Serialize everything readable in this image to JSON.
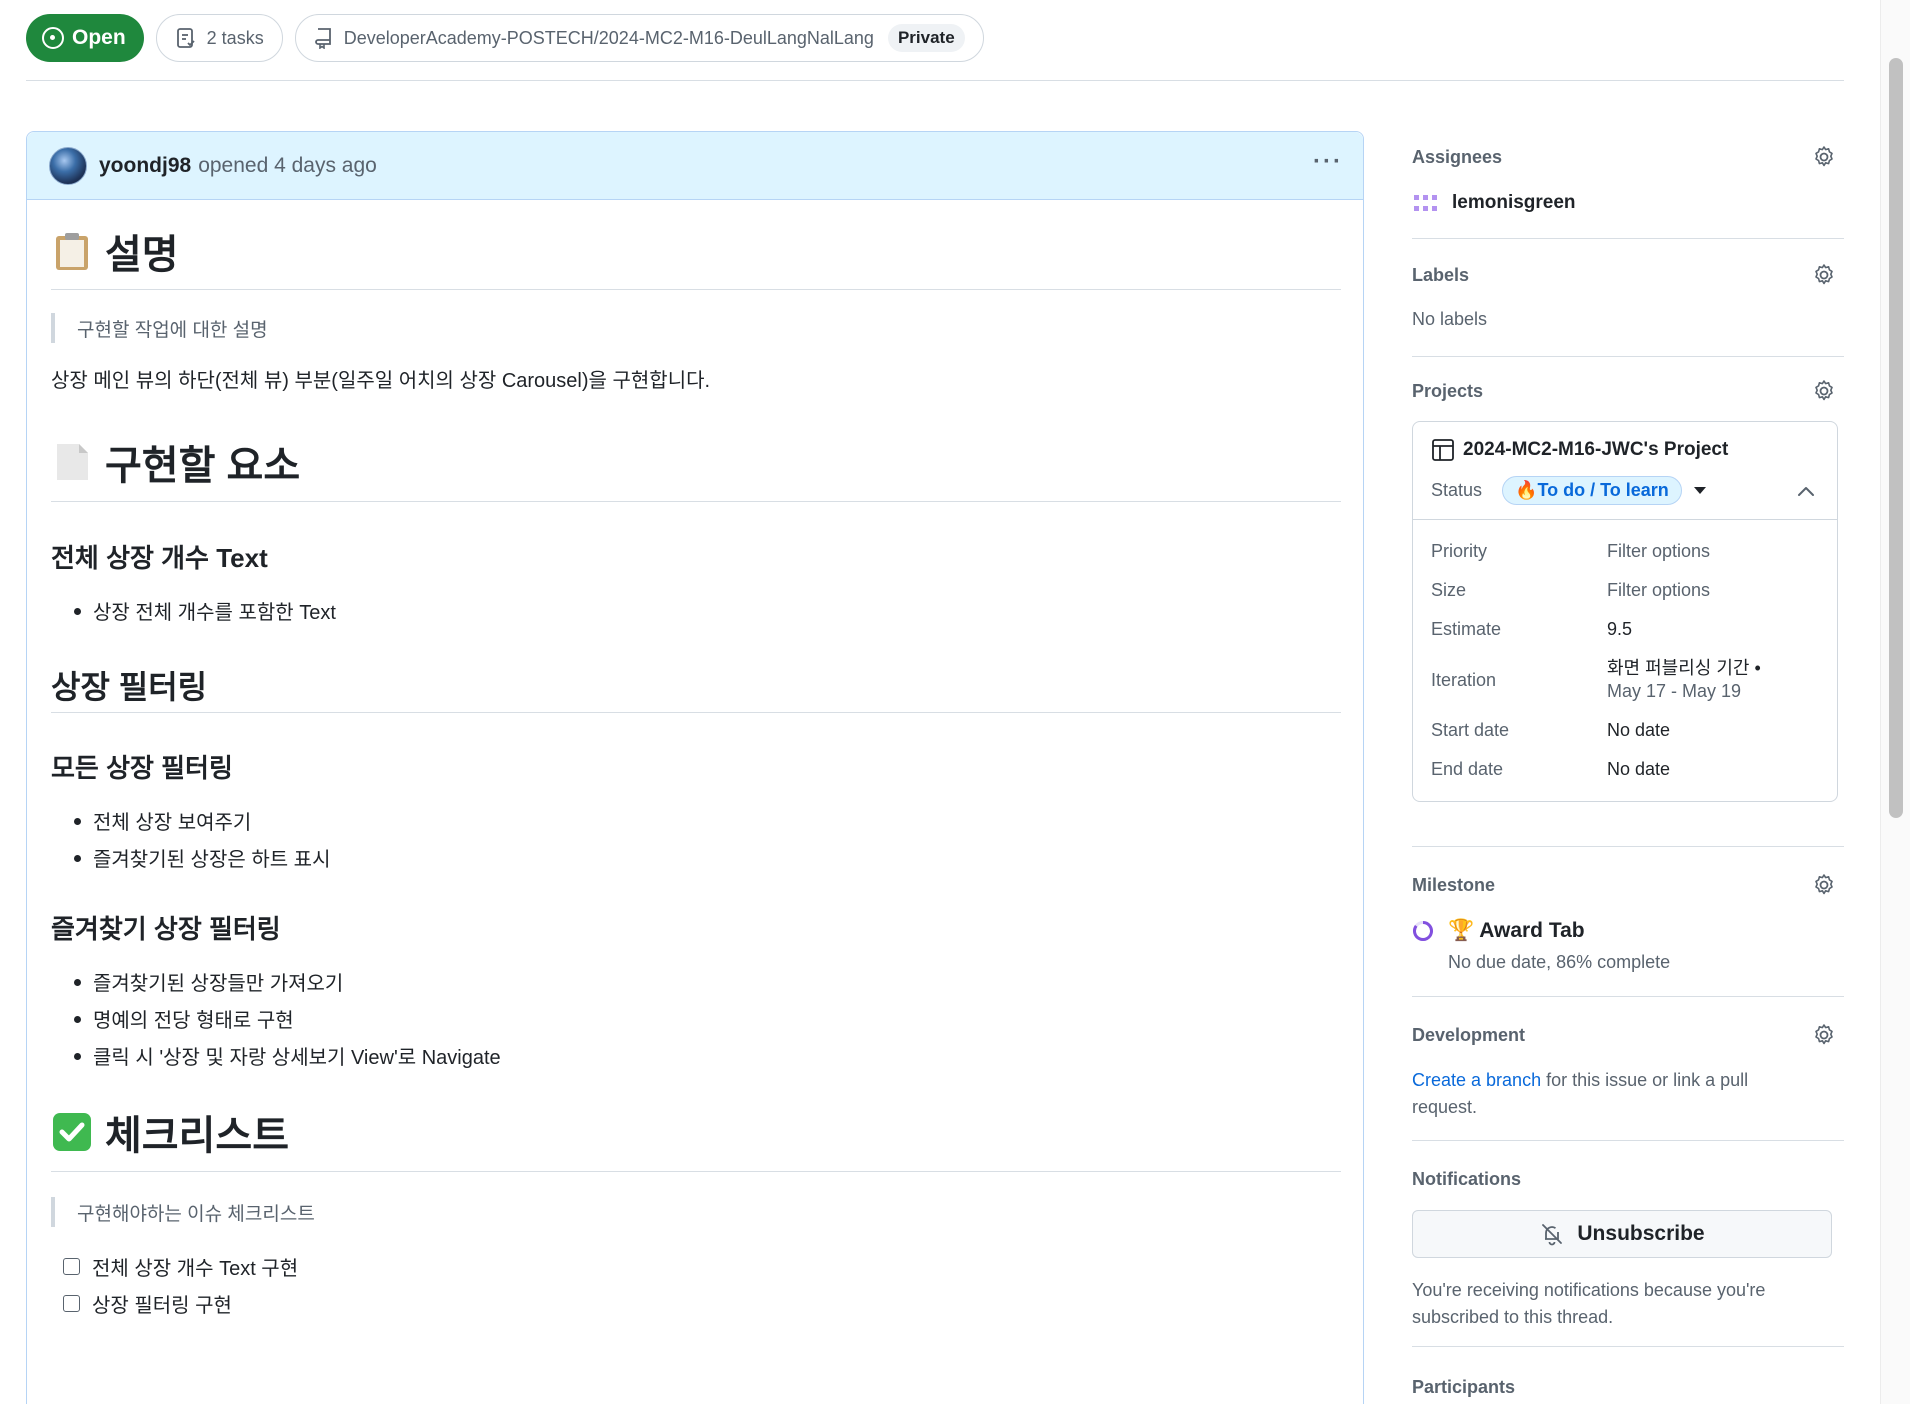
{
  "topbar": {
    "state": "Open",
    "tasks": "2 tasks",
    "repo": "DeveloperAcademy-POSTECH/2024-MC2-M16-DeulLangNalLang",
    "visibility": "Private"
  },
  "comment": {
    "author": "yoondj98",
    "opened": "opened 4 days ago",
    "heading1": "설명",
    "quote1": "구현할 작업에 대한 설명",
    "para1": "상장 메인 뷰의 하단(전체 뷰) 부분(일주일 어치의 상장 Carousel)을 구현합니다.",
    "heading2": "구현할 요소",
    "h3_total": "전체 상장 개수 Text",
    "list_total": [
      "상장 전체 개수를 포함한 Text"
    ],
    "h2_filter": "상장 필터링",
    "h3_all": "모든 상장 필터링",
    "list_all": [
      "전체 상장 보여주기",
      "즐겨찾기된 상장은 하트 표시"
    ],
    "h3_fav": "즐겨찾기 상장 필터링",
    "list_fav": [
      "즐겨찾기된 상장들만 가져오기",
      "명예의 전당 형태로 구현",
      "클릭 시 '상장 및 자랑 상세보기 View'로 Navigate"
    ],
    "heading3": "체크리스트",
    "quote2": "구현해야하는 이슈 체크리스트",
    "tasks": [
      "전체 상장 개수 Text 구현",
      "상장 필터링 구현"
    ]
  },
  "sidebar": {
    "assignees_title": "Assignees",
    "assignee": "lemonisgreen",
    "labels_title": "Labels",
    "labels_value": "No labels",
    "projects_title": "Projects",
    "project_name": "2024-MC2-M16-JWC's Project",
    "status_label": "Status",
    "status_value": "🔥To do / To learn",
    "fields": [
      {
        "key": "Priority",
        "value": "Filter options"
      },
      {
        "key": "Size",
        "value": "Filter options"
      },
      {
        "key": "Estimate",
        "value": "9.5"
      },
      {
        "key": "Iteration",
        "value": "화면 퍼블리싱 기간 •",
        "value2": "May 17 - May 19"
      },
      {
        "key": "Start date",
        "value": "No date"
      },
      {
        "key": "End date",
        "value": "No date"
      }
    ],
    "milestone_title": "Milestone",
    "milestone_name": "🏆 Award Tab",
    "milestone_meta": "No due date, 86% complete",
    "development_title": "Development",
    "dev_link": "Create a branch",
    "dev_text": " for this issue or link a pull request.",
    "notifications_title": "Notifications",
    "unsubscribe": "Unsubscribe",
    "notif_text": "You're receiving notifications because you're subscribed to this thread.",
    "participants_title": "Participants"
  },
  "colors": {
    "open_green": "#1f883d",
    "accent_blue": "#0969da",
    "header_bg": "#ddf4ff"
  }
}
